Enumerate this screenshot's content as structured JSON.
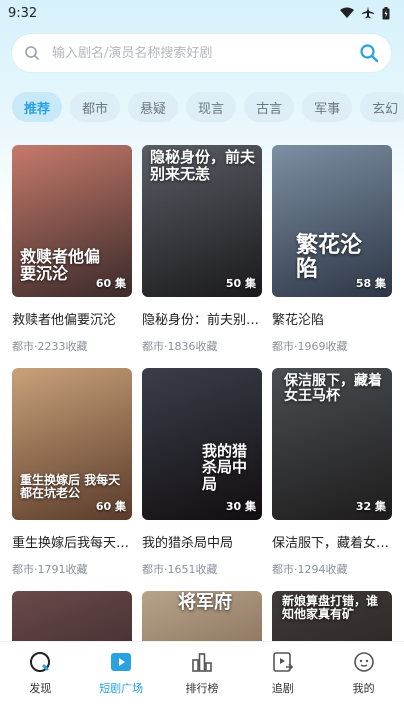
{
  "status": {
    "time": "9:32"
  },
  "search": {
    "placeholder": "输入剧名/演员名称搜索好剧"
  },
  "tabs": [
    {
      "label": "推荐",
      "active": true
    },
    {
      "label": "都市",
      "active": false
    },
    {
      "label": "悬疑",
      "active": false
    },
    {
      "label": "现言",
      "active": false
    },
    {
      "label": "古言",
      "active": false
    },
    {
      "label": "军事",
      "active": false
    },
    {
      "label": "玄幻",
      "active": false
    }
  ],
  "dramas": [
    {
      "title": "救赎者他偏要沉沦",
      "meta": "都市·2233收藏",
      "episodes": "60 集",
      "poster_text": "救赎者他偏要沉沦",
      "colors": [
        "#c67a6a",
        "#3a2a2a"
      ]
    },
    {
      "title": "隐秘身份：前夫别来无恙",
      "meta": "都市·1836收藏",
      "episodes": "50 集",
      "poster_text": "隐秘身份，前夫别来无恙",
      "colors": [
        "#5b5d66",
        "#1a1a1c"
      ]
    },
    {
      "title": "繁花沦陷",
      "meta": "都市·1969收藏",
      "episodes": "58 集",
      "poster_text": "繁花沦陷",
      "colors": [
        "#7d8fa3",
        "#2d3646"
      ]
    },
    {
      "title": "重生换嫁后我每天都在坑老公",
      "meta": "都市·1791收藏",
      "episodes": "60 集",
      "poster_text": "重生换嫁后 我每天都在坑老公",
      "colors": [
        "#c9a27a",
        "#5a3a2a"
      ]
    },
    {
      "title": "我的猎杀局中局",
      "meta": "都市·1651收藏",
      "episodes": "30 集",
      "poster_text": "我的猎杀局中局",
      "colors": [
        "#3a3e4a",
        "#120e10"
      ]
    },
    {
      "title": "保洁服下，藏着女王的马杯",
      "meta": "都市·1294收藏",
      "episodes": "32 集",
      "poster_text": "保洁服下，藏着女王马杯",
      "colors": [
        "#4a4e52",
        "#1e1c1c"
      ]
    },
    {
      "title": "",
      "meta": "",
      "episodes": "",
      "poster_text": "",
      "colors": [
        "#6a4a4a",
        "#2a1a1e"
      ]
    },
    {
      "title": "",
      "meta": "",
      "episodes": "",
      "poster_text": "将军府",
      "colors": [
        "#b7a48a",
        "#6a4b3a"
      ]
    },
    {
      "title": "",
      "meta": "",
      "episodes": "",
      "poster_text": "新娘算盘打错，谁知他家真有矿",
      "colors": [
        "#403a3a",
        "#1e1a1a"
      ]
    }
  ],
  "nav": [
    {
      "label": "发现",
      "icon": "discover-icon",
      "active": false
    },
    {
      "label": "短剧广场",
      "icon": "play-square-icon",
      "active": true
    },
    {
      "label": "排行榜",
      "icon": "ranking-icon",
      "active": false
    },
    {
      "label": "追剧",
      "icon": "follow-icon",
      "active": false
    },
    {
      "label": "我的",
      "icon": "profile-icon",
      "active": false
    }
  ],
  "colors": {
    "accent": "#2aa1e0",
    "tab_bg": "#ddeef6"
  }
}
